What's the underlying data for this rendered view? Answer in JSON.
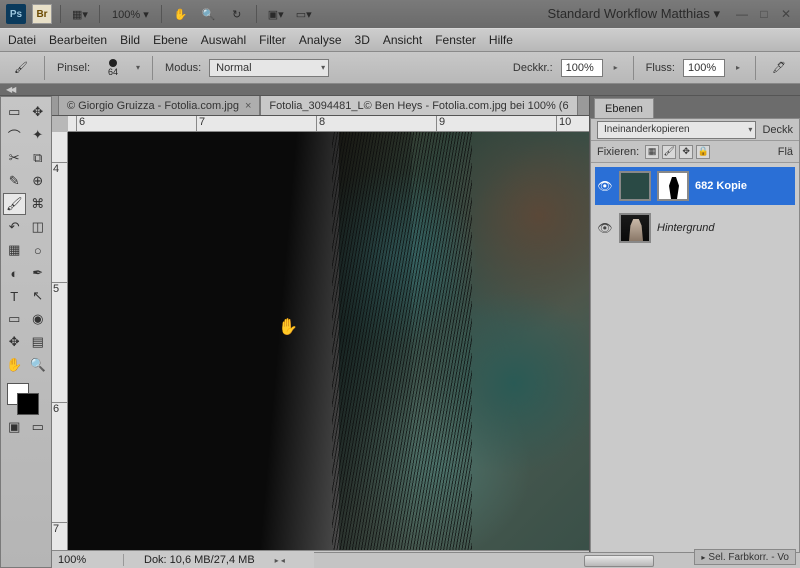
{
  "title_bar": {
    "zoom": "100% ▾",
    "workspace": "Standard Workflow Matthias ▾"
  },
  "menu": [
    "Datei",
    "Bearbeiten",
    "Bild",
    "Ebene",
    "Auswahl",
    "Filter",
    "Analyse",
    "3D",
    "Ansicht",
    "Fenster",
    "Hilfe"
  ],
  "options": {
    "brush_label": "Pinsel:",
    "brush_size": "64",
    "mode_label": "Modus:",
    "mode_value": "Normal",
    "opacity_label": "Deckkr.:",
    "opacity_value": "100%",
    "flow_label": "Fluss:",
    "flow_value": "100%"
  },
  "tabs": [
    {
      "label": "© Giorgio Gruizza - Fotolia.com.jpg",
      "active": false
    },
    {
      "label": "Fotolia_3094481_L© Ben Heys - Fotolia.com.jpg bei 100% (6",
      "active": true
    }
  ],
  "ruler_h": [
    "6",
    "7",
    "8",
    "9",
    "10"
  ],
  "ruler_v": [
    "4",
    "5",
    "6",
    "7"
  ],
  "status": {
    "zoom": "100%",
    "doc": "Dok: 10,6 MB/27,4 MB"
  },
  "layers_panel": {
    "tab": "Ebenen",
    "blend": "Ineinanderkopieren",
    "opacity_label": "Deckk",
    "lock_label": "Fixieren:",
    "fill_label": "Flä",
    "layers": [
      {
        "name": "682 Kopie",
        "selected": true,
        "has_mask": true
      },
      {
        "name": "Hintergrund",
        "selected": false,
        "italic": true
      }
    ]
  },
  "corner": "Sel. Farbkorr. - Vo"
}
